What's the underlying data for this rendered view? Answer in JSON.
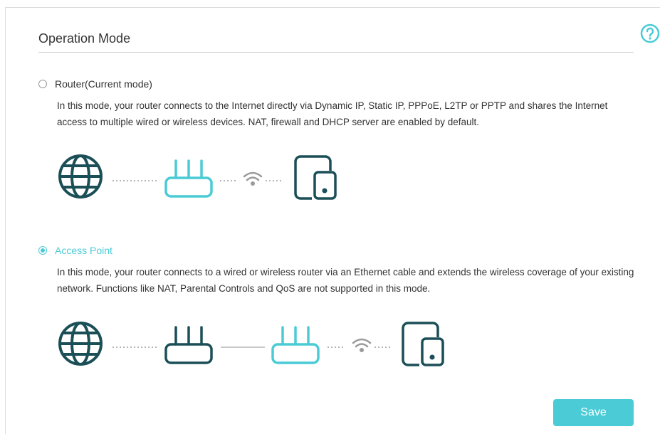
{
  "header": {
    "title": "Operation Mode",
    "help_icon": "question-circle-icon"
  },
  "modes": [
    {
      "label": "Router(Current mode)",
      "selected": false,
      "description": "In this mode, your router connects to the Internet directly via Dynamic IP, Static IP, PPPoE, L2TP or PPTP and shares the Internet access to multiple wired or wireless devices. NAT, firewall and DHCP server are enabled by default.",
      "diagram": [
        "globe-icon",
        "router-icon",
        "wifi-icon",
        "device-icon"
      ]
    },
    {
      "label": "Access Point",
      "selected": true,
      "description": "In this mode, your router connects to a wired or wireless router via an Ethernet cable and extends the wireless coverage of your existing network. Functions like NAT, Parental Controls and QoS are not supported in this mode.",
      "diagram": [
        "globe-icon",
        "router-icon",
        "router-icon",
        "wifi-icon",
        "device-icon"
      ]
    }
  ],
  "footer": {
    "save_label": "Save"
  },
  "colors": {
    "accent": "#4acbd6",
    "dark_icon": "#1b4f57",
    "text": "#333333",
    "muted": "#9a9a9a"
  }
}
